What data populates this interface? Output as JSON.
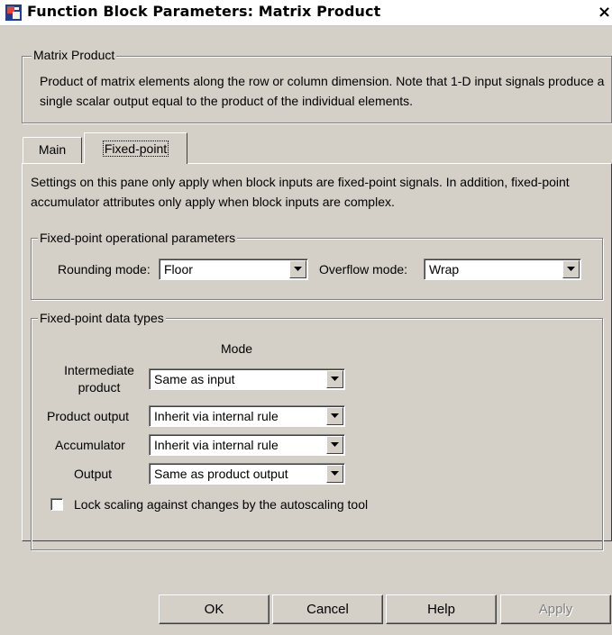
{
  "window": {
    "title": "Function Block Parameters: Matrix Product",
    "close_glyph": "×",
    "icon": "simulink-block-icon"
  },
  "description": {
    "group_title": "Matrix Product",
    "text": "Product of matrix elements along the row or column dimension. Note that 1-D input signals produce a single scalar output equal to the product of the individual elements."
  },
  "tabs": [
    {
      "label": "Main",
      "selected": false
    },
    {
      "label": "Fixed-point",
      "selected": true
    }
  ],
  "panel": {
    "info_text": "Settings on this pane only apply when block inputs are fixed-point signals. In addition, fixed-point accumulator attributes only apply when block inputs are complex.",
    "operational": {
      "group_title": "Fixed-point operational parameters",
      "rounding_label": "Rounding mode:",
      "rounding_value": "Floor",
      "overflow_label": "Overflow mode:",
      "overflow_value": "Wrap"
    },
    "datatypes": {
      "group_title": "Fixed-point data types",
      "mode_header": "Mode",
      "rows": [
        {
          "label": "Intermediate product",
          "value": "Same as input"
        },
        {
          "label": "Product output",
          "value": "Inherit via internal rule"
        },
        {
          "label": "Accumulator",
          "value": "Inherit via internal rule"
        },
        {
          "label": "Output",
          "value": "Same as product output"
        }
      ],
      "intermediate_line1": "Intermediate",
      "intermediate_line2": "product",
      "lock_label": "Lock scaling against changes by the autoscaling tool",
      "lock_checked": false
    }
  },
  "buttons": {
    "ok": "OK",
    "cancel": "Cancel",
    "help": "Help",
    "apply": "Apply",
    "apply_enabled": false
  },
  "colors": {
    "dialog_bg": "#d4d0c8",
    "disabled_text": "#808080"
  }
}
